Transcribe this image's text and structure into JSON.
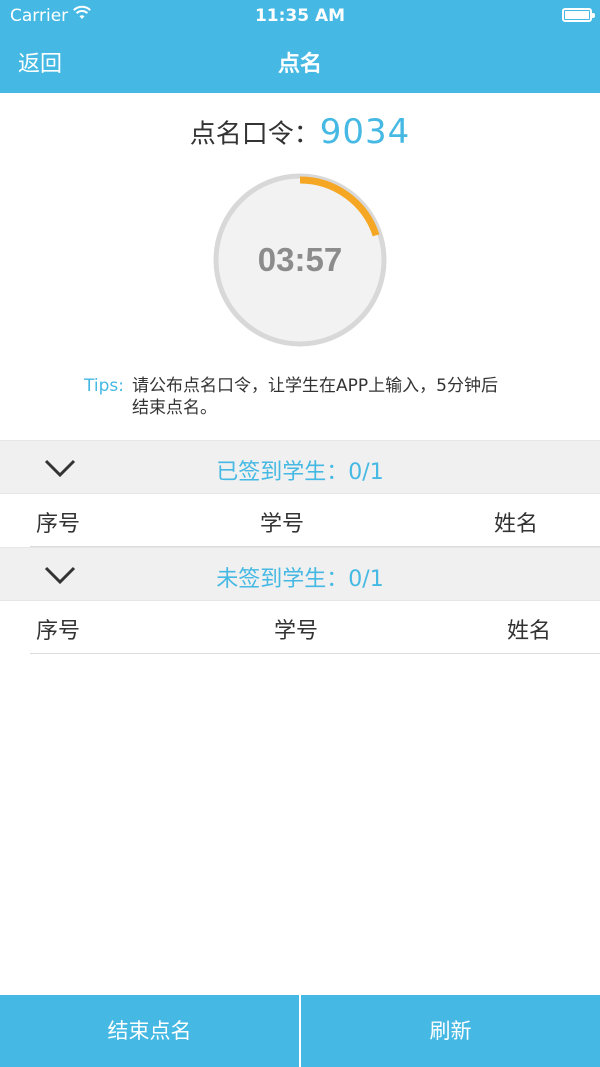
{
  "status_bar": {
    "carrier": "Carrier",
    "time": "11:35 AM"
  },
  "nav": {
    "back_label": "返回",
    "title": "点名"
  },
  "rollcall": {
    "code_label": "点名口令：",
    "code_value": "9034"
  },
  "timer": {
    "display": "03:57",
    "progress_fraction": 0.2,
    "progress_color": "#f5a623",
    "track_color": "#d8d8d8"
  },
  "tips": {
    "label": "Tips:",
    "text": "请公布点名口令，让学生在APP上输入，5分钟后结束点名。"
  },
  "signed_section": {
    "title": "已签到学生：0/1",
    "columns": [
      "序号",
      "学号",
      "姓名"
    ]
  },
  "unsigned_section": {
    "title": "未签到学生：0/1",
    "columns": [
      "序号",
      "学号",
      "姓名"
    ]
  },
  "bottom": {
    "end_label": "结束点名",
    "refresh_label": "刷新"
  },
  "colors": {
    "accent": "#45b9e3",
    "header_bg": "#f0f0f0"
  }
}
